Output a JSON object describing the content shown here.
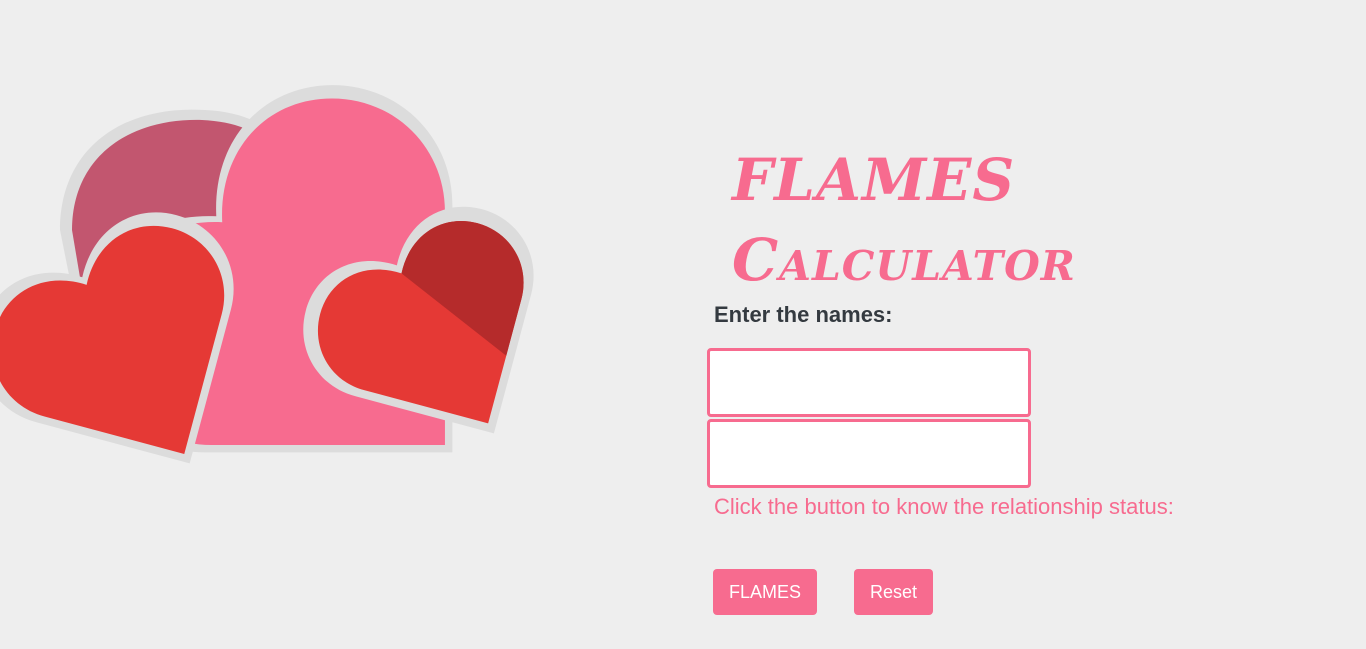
{
  "title": {
    "line1": "FLAMES",
    "line2": "Calculator"
  },
  "form": {
    "prompt": "Enter the names:",
    "name1_value": "",
    "name2_value": "",
    "instruction": "Click the button to know the relationship status:",
    "flames_button": "FLAMES",
    "reset_button": "Reset"
  },
  "colors": {
    "accent": "#f76b8f",
    "heart_dark_pink": "#c2566f",
    "heart_red": "#e53935",
    "heart_dark_red": "#b52b2b",
    "background": "#eeeeee"
  }
}
